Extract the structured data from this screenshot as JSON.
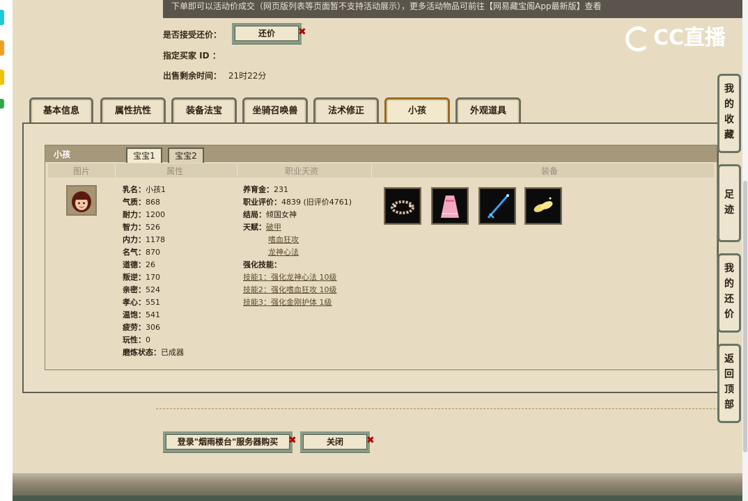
{
  "notice": "下单即可以活动价成交（网页版列表等页面暂不支持活动展示），更多活动物品可前往【网易藏宝阁App最新版】查看",
  "form": {
    "accept_counter_label": "是否接受还价：",
    "counter_button": "还价",
    "buyer_id_label": "指定买家 ID ：",
    "time_left_label": "出售剩余时间：",
    "time_left_value": "21时22分"
  },
  "logo": {
    "text": "CC直播"
  },
  "tabs": [
    "基本信息",
    "属性抗性",
    "装备法宝",
    "坐骑召唤兽",
    "法术修正",
    "小孩",
    "外观道具"
  ],
  "active_tab": "小孩",
  "child_panel": {
    "title": "小孩",
    "subtabs": [
      "宝宝1",
      "宝宝2"
    ],
    "active_subtab": "宝宝1",
    "columns": [
      "图片",
      "属性",
      "职业天资",
      "装备"
    ],
    "attributes": [
      {
        "k": "乳名：",
        "v": "小孩1"
      },
      {
        "k": "气质：",
        "v": "868"
      },
      {
        "k": "耐力：",
        "v": "1200"
      },
      {
        "k": "智力：",
        "v": "526"
      },
      {
        "k": "内力：",
        "v": "1178"
      },
      {
        "k": "名气：",
        "v": "870"
      },
      {
        "k": "道德：",
        "v": "26"
      },
      {
        "k": "叛逆：",
        "v": "170"
      },
      {
        "k": "亲密：",
        "v": "524"
      },
      {
        "k": "孝心：",
        "v": "551"
      },
      {
        "k": "温饱：",
        "v": "541"
      },
      {
        "k": "疲劳：",
        "v": "306"
      },
      {
        "k": "玩性：",
        "v": "0"
      },
      {
        "k": "磨炼状态：",
        "v": "已成器"
      }
    ],
    "career": {
      "upbringing_label": "养育金：",
      "upbringing_value": "231",
      "eval_label": "职业评价：",
      "eval_value": "4839 (旧评价4761)",
      "ending_label": "结局：",
      "ending_value": "倾国女神",
      "talent_label": "天赋：",
      "talents": [
        "破甲",
        "嗜血狂攻",
        "龙神心法"
      ],
      "enhance_label": "强化技能：",
      "skills": [
        "技能1：强化龙神心法 10级",
        "技能2：强化嗜血狂攻 10级",
        "技能3：强化金刚护体 1级"
      ]
    },
    "equipment_icons": [
      "flower-wreath-icon",
      "pink-dress-icon",
      "blue-sword-icon",
      "golden-shoes-icon"
    ]
  },
  "buttons": {
    "login_buy": "登录\"烟雨楼台\"服务器购买",
    "close": "关闭"
  },
  "side_nav": [
    "我的收藏",
    "足迹",
    "我的还价",
    "返回顶部"
  ],
  "colors": {
    "page_bg": "#e7dcc2",
    "active_tab_border": "#9a6a1e",
    "notice_bg": "#5a544c",
    "x_mark": "#b00000"
  }
}
